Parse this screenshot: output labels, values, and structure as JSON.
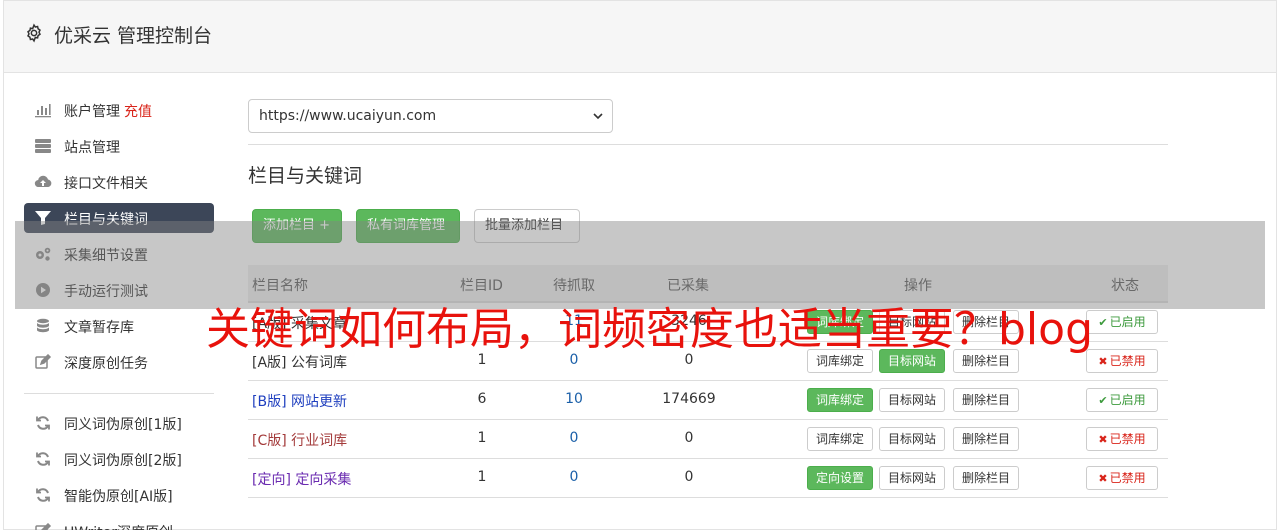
{
  "header": {
    "title": "优采云 管理控制台",
    "icon": "gear-icon"
  },
  "sidebar": {
    "items": [
      {
        "label": "账户管理",
        "extra": "充值",
        "icon": "bar-chart-icon"
      },
      {
        "label": "站点管理",
        "icon": "server-icon"
      },
      {
        "label": "接口文件相关",
        "icon": "cloud-upload-icon"
      },
      {
        "label": "栏目与关键词",
        "icon": "filter-icon",
        "active": true
      },
      {
        "label": "采集细节设置",
        "icon": "gears-icon"
      },
      {
        "label": "手动运行测试",
        "icon": "play-circle-icon"
      },
      {
        "label": "文章暂存库",
        "icon": "database-icon"
      },
      {
        "label": "深度原创任务",
        "icon": "edit-icon"
      }
    ],
    "items2": [
      {
        "label": "同义词伪原创[1版]",
        "icon": "refresh-icon"
      },
      {
        "label": "同义词伪原创[2版]",
        "icon": "refresh-icon"
      },
      {
        "label": "智能伪原创[AI版]",
        "icon": "refresh-icon"
      },
      {
        "label": "UWriter深度原创",
        "icon": "edit-icon"
      }
    ]
  },
  "main": {
    "site_select": "https://www.ucaiyun.com",
    "section_title": "栏目与关键词",
    "buttons": {
      "add_column": "添加栏目 +",
      "private_lib": "私有词库管理",
      "batch_add": "批量添加栏目"
    }
  },
  "table": {
    "headers": {
      "name": "栏目名称",
      "id": "栏目ID",
      "pending": "待抓取",
      "collected": "已采集",
      "ops": "操作",
      "status": "状态"
    },
    "rows": [
      {
        "name": "[A版] 采集文章",
        "id": "",
        "pending": "11",
        "collected": "3246",
        "op1": "词库绑定",
        "op1_green": true,
        "op2": "目标网站",
        "op2_green": false,
        "op3": "删除栏目",
        "status": "已启用",
        "status_on": true,
        "tag": "a"
      },
      {
        "name": "[A版] 公有词库",
        "id": "1",
        "pending": "0",
        "collected": "0",
        "op1": "词库绑定",
        "op1_green": false,
        "op2": "目标网站",
        "op2_green": true,
        "op3": "删除栏目",
        "status": "已禁用",
        "status_on": false,
        "tag": "a"
      },
      {
        "name": "[B版] 网站更新",
        "id": "6",
        "pending": "10",
        "collected": "174669",
        "op1": "词库绑定",
        "op1_green": true,
        "op2": "目标网站",
        "op2_green": false,
        "op3": "删除栏目",
        "status": "已启用",
        "status_on": true,
        "tag": "b"
      },
      {
        "name": "[C版] 行业词库",
        "id": "1",
        "pending": "0",
        "collected": "0",
        "op1": "词库绑定",
        "op1_green": false,
        "op2": "目标网站",
        "op2_green": false,
        "op3": "删除栏目",
        "status": "已禁用",
        "status_on": false,
        "tag": "c"
      },
      {
        "name": "[定向] 定向采集",
        "id": "1",
        "pending": "0",
        "collected": "0",
        "op1": "定向设置",
        "op1_green": true,
        "op2": "目标网站",
        "op2_green": false,
        "op3": "删除栏目",
        "status": "已禁用",
        "status_on": false,
        "tag": "d"
      }
    ]
  },
  "overlay": {
    "text": "关键词如何布局，词频密度也适当重要？blog"
  },
  "colors": {
    "green": "#5cb85c",
    "active_nav": "#3c4658",
    "overlay_red": "#e8120c",
    "recharge_red": "#d9241a"
  }
}
